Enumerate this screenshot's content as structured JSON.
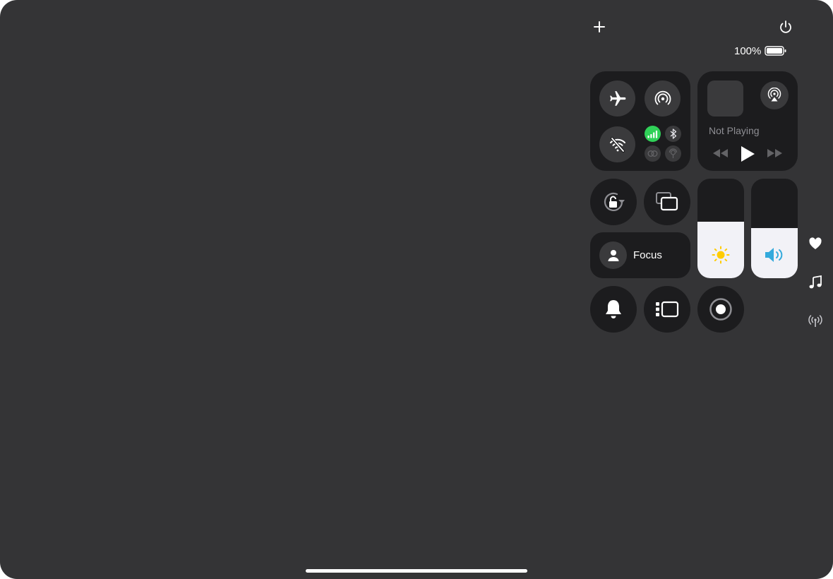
{
  "status": {
    "battery_percent": "100%",
    "battery_level": 1.0,
    "battery_icon": "battery-icon"
  },
  "top_bar": {
    "add_icon": "plus-icon",
    "power_icon": "power-icon"
  },
  "connectivity": {
    "airplane_icon": "airplane-icon",
    "airdrop_icon": "airdrop-icon",
    "wifi_icon": "wifi-off-icon",
    "cellular_icon": "cellular-icon",
    "bluetooth_icon": "bluetooth-icon",
    "hotspot_icon": "personal-hotspot-icon",
    "satellite_icon": "satellite-icon",
    "cellular_color": "#30d158"
  },
  "now_playing": {
    "status_text": "Not Playing",
    "airplay_icon": "airplay-audio-icon"
  },
  "controls": {
    "focus_label": "Focus",
    "orientation_lock_icon": "orientation-lock-icon",
    "screen_mirroring_icon": "screen-mirroring-icon",
    "bell_icon": "bell-icon",
    "stage_manager_icon": "stage-manager-icon",
    "screen_record_icon": "screen-record-icon"
  },
  "sliders": {
    "brightness_level": 0.57,
    "volume_level": 0.5,
    "brightness_color": "#ffcc00",
    "volume_color": "#34aadc"
  },
  "side_icons": {
    "heart_icon": "heart-icon",
    "music_icon": "music-note-icon",
    "antenna_icon": "antenna-icon"
  }
}
